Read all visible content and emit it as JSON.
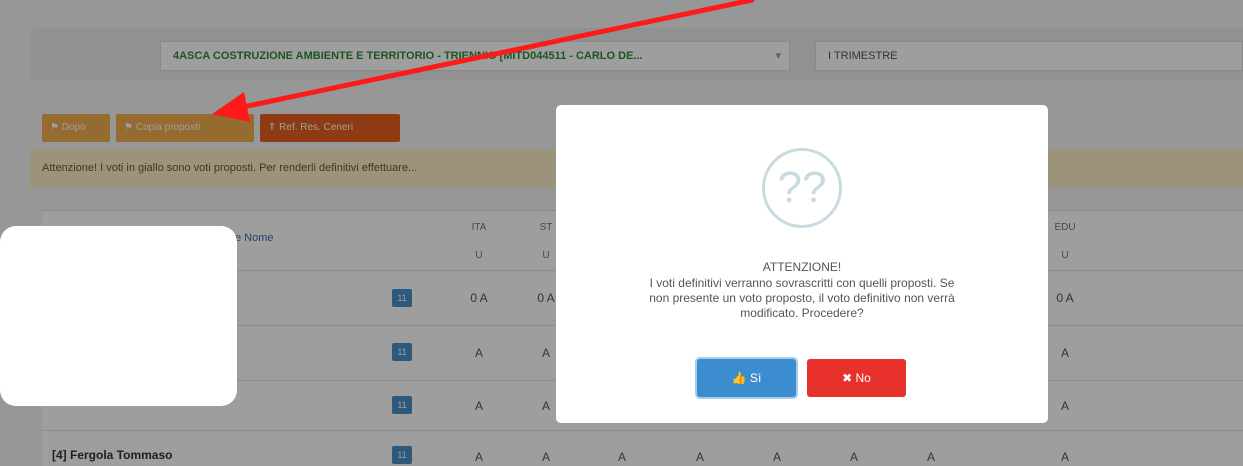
{
  "filters": {
    "class_value": "4ASCA COSTRUZIONE AMBIENTE E TERRITORIO - TRIENNIO [MITD044511 - CARLO DE...",
    "class_caret": "▾",
    "period_value": "I TRIMESTRE"
  },
  "toolbar": {
    "btn1_label": "⚑ Dopo",
    "btn2_label": "⚑ Copia proposti",
    "btn3_label": "⇑ Ref. Res. Ceneri"
  },
  "notice": "Attenzione! I voti in giallo sono voti proposti. Per renderli definitivi effettuare...",
  "grid": {
    "name_header": "e Nome",
    "subjects": [
      {
        "code": "ITA",
        "type": "U"
      },
      {
        "code": "ST",
        "type": "U"
      },
      {
        "code": "EDU",
        "type": "U"
      }
    ],
    "rows": [
      {
        "name": "",
        "badge": "11",
        "grades": [
          "0 A",
          "0 A",
          "0 A"
        ]
      },
      {
        "name": "",
        "badge": "11",
        "grades": [
          "A",
          "A",
          "A"
        ]
      },
      {
        "name": "",
        "badge": "11",
        "grades": [
          "A",
          "A",
          "A"
        ]
      },
      {
        "name": "[4] Fergola Tommaso",
        "badge": "11",
        "grades": [
          "A",
          "A",
          "A",
          "A",
          "A",
          "A",
          "A",
          "A"
        ]
      }
    ]
  },
  "modal": {
    "icon_glyph": "??",
    "title": "ATTENZIONE!",
    "line1": "I voti definitivi verranno sovrascritti con quelli proposti. Se",
    "line2": "non presente un voto proposto, il voto definitivo non verrà",
    "line3": "modificato. Procedere?",
    "yes_label": "👍 Sì",
    "no_label": "✖ No"
  },
  "colors": {
    "arrow": "#ff1a1a",
    "yes_button": "#3c8dd0",
    "no_button": "#e8312b",
    "toolbar_yellow": "#f0ad4e",
    "toolbar_orange": "#e65e1e"
  }
}
